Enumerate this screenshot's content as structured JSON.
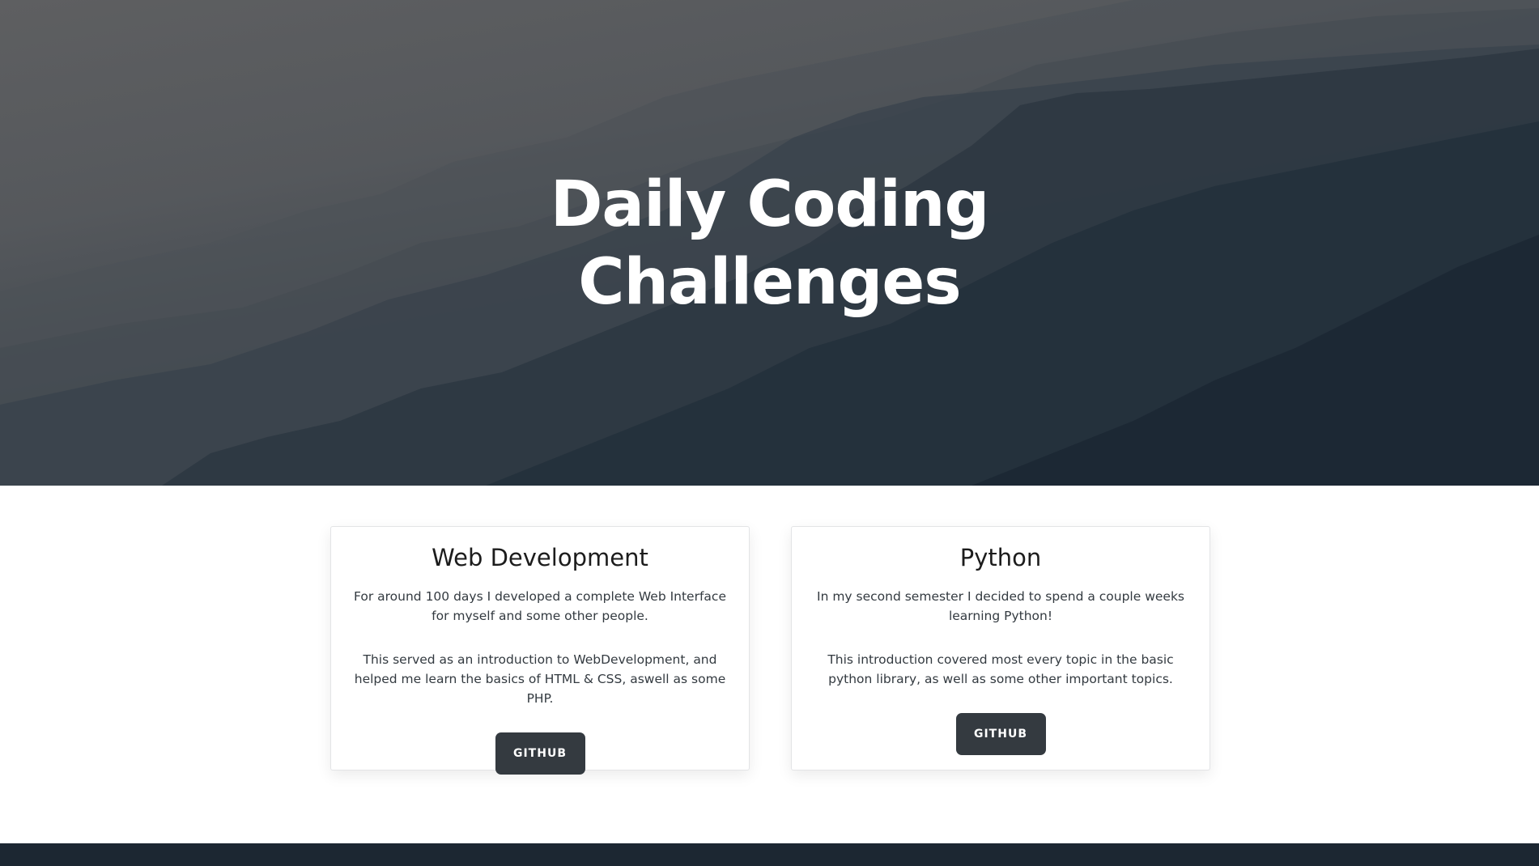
{
  "hero": {
    "title_line1": "Daily Coding",
    "title_line2": "Challenges"
  },
  "cards": [
    {
      "title": "Web Development",
      "paragraph1": "For around 100 days I developed a complete Web Interface for myself and some other people.",
      "paragraph2": "This served as an introduction to WebDevelopment, and helped me learn the basics of HTML & CSS, aswell as some PHP.",
      "button_label": "GITHUB"
    },
    {
      "title": "Python",
      "paragraph1": "In my second semester I decided to spend a couple weeks learning Python!",
      "paragraph2": "This introduction covered most every topic in the basic python library, as well as some other important topics.",
      "button_label": "GITHUB"
    }
  ],
  "colors": {
    "button_bg": "#343a40",
    "footer_bg": "#1c2732",
    "hero_dark": "#1f2a35"
  }
}
